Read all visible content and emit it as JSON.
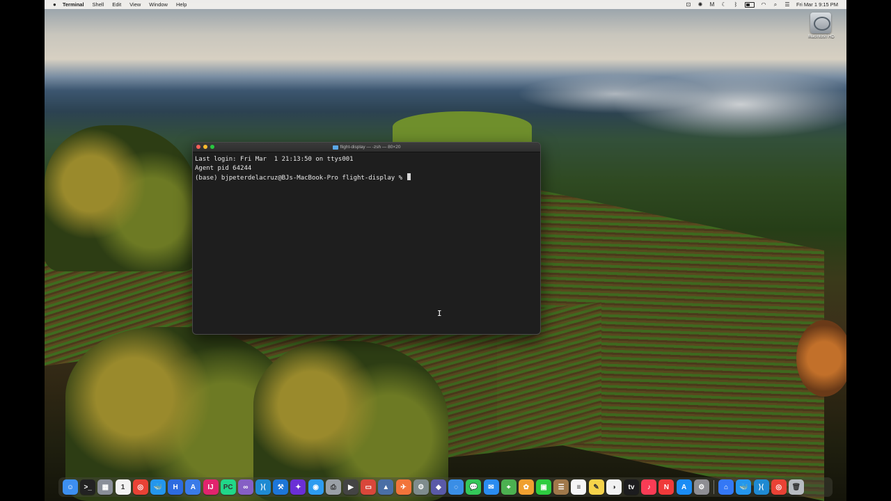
{
  "menubar": {
    "app_name": "Terminal",
    "items": [
      "Shell",
      "Edit",
      "View",
      "Window",
      "Help"
    ],
    "clock": "Fri Mar 1  9:15 PM"
  },
  "desktop": {
    "disk_label": "Macintosh HD"
  },
  "terminal": {
    "title": "flight-display — -zsh — 80×20",
    "lines": [
      "Last login: Fri Mar  1 21:13:50 on ttys001",
      "Agent pid 64244",
      "(base) bjpeterdelacruz@BJs-MacBook-Pro flight-display % "
    ],
    "cursor_glyph": "I"
  },
  "dock": {
    "apps": [
      {
        "name": "finder-icon",
        "glyph": "☺",
        "color": "#3d8ff0"
      },
      {
        "name": "terminal-icon",
        "glyph": ">_",
        "color": "#222222"
      },
      {
        "name": "launchpad-icon",
        "glyph": "▦",
        "color": "#8a8f99"
      },
      {
        "name": "calendar-icon",
        "glyph": "1",
        "color": "#f2f2f2"
      },
      {
        "name": "chrome-icon",
        "glyph": "◎",
        "color": "#e94235"
      },
      {
        "name": "docker-icon",
        "glyph": "🐳",
        "color": "#2496ed"
      },
      {
        "name": "h-app-icon",
        "glyph": "H",
        "color": "#2d6be0"
      },
      {
        "name": "font-app-icon",
        "glyph": "A",
        "color": "#3a7be8"
      },
      {
        "name": "intellij-icon",
        "glyph": "IJ",
        "color": "#e2246e"
      },
      {
        "name": "pycharm-icon",
        "glyph": "PC",
        "color": "#21d789"
      },
      {
        "name": "visual-studio-icon",
        "glyph": "∞",
        "color": "#865fc5"
      },
      {
        "name": "vscode-icon",
        "glyph": "⟩⟨",
        "color": "#1f8ad2"
      },
      {
        "name": "xcode-icon",
        "glyph": "⚒",
        "color": "#1d76d8"
      },
      {
        "name": "rider-icon",
        "glyph": "✦",
        "color": "#6b2fd6"
      },
      {
        "name": "safari-icon",
        "glyph": "◉",
        "color": "#2d9cf0"
      },
      {
        "name": "printer-icon",
        "glyph": "⎙",
        "color": "#9aa0a6"
      },
      {
        "name": "final-cut-icon",
        "glyph": "▶",
        "color": "#444444"
      },
      {
        "name": "presentation-icon",
        "glyph": "▭",
        "color": "#d9473a"
      },
      {
        "name": "cone-app-icon",
        "glyph": "▲",
        "color": "#4a6fa5"
      },
      {
        "name": "swift-icon",
        "glyph": "✈",
        "color": "#f2743a"
      },
      {
        "name": "utility-icon",
        "glyph": "⚙",
        "color": "#7f8c8d"
      },
      {
        "name": "cube-app-icon",
        "glyph": "◆",
        "color": "#5a5aa8"
      },
      {
        "name": "compass-icon",
        "glyph": "◌",
        "color": "#3a8ee6"
      },
      {
        "name": "messages-icon",
        "glyph": "💬",
        "color": "#34c759"
      },
      {
        "name": "mail-icon",
        "glyph": "✉",
        "color": "#2a8cf0"
      },
      {
        "name": "maps-icon",
        "glyph": "⌖",
        "color": "#4cb050"
      },
      {
        "name": "photos-icon",
        "glyph": "✿",
        "color": "#f0a030"
      },
      {
        "name": "facetime-icon",
        "glyph": "▣",
        "color": "#2ecc40"
      },
      {
        "name": "contacts-icon",
        "glyph": "☰",
        "color": "#a0784a"
      },
      {
        "name": "reminders-icon",
        "glyph": "≡",
        "color": "#f5f5f5"
      },
      {
        "name": "notes-icon",
        "glyph": "✎",
        "color": "#f6d34a"
      },
      {
        "name": "freeform-icon",
        "glyph": "◑",
        "color": "#f2f2f2"
      },
      {
        "name": "apple-tv-icon",
        "glyph": "tv",
        "color": "#1c1c1e"
      },
      {
        "name": "music-icon",
        "glyph": "♪",
        "color": "#fa3c55"
      },
      {
        "name": "news-icon",
        "glyph": "N",
        "color": "#f03a3a"
      },
      {
        "name": "app-store-icon",
        "glyph": "A",
        "color": "#1a8cf5"
      },
      {
        "name": "system-settings-icon",
        "glyph": "⚙",
        "color": "#8e8e93"
      }
    ],
    "recent": [
      {
        "name": "recent-app-icon",
        "glyph": "⌂",
        "color": "#3478f6"
      },
      {
        "name": "recent-docker-icon",
        "glyph": "🐳",
        "color": "#2496ed"
      },
      {
        "name": "recent-vscode-icon",
        "glyph": "⟩⟨",
        "color": "#1f8ad2"
      },
      {
        "name": "recent-chrome-icon",
        "glyph": "◎",
        "color": "#e94235"
      },
      {
        "name": "trash-icon",
        "glyph": "🗑",
        "color": "#b8bcc2"
      }
    ]
  }
}
